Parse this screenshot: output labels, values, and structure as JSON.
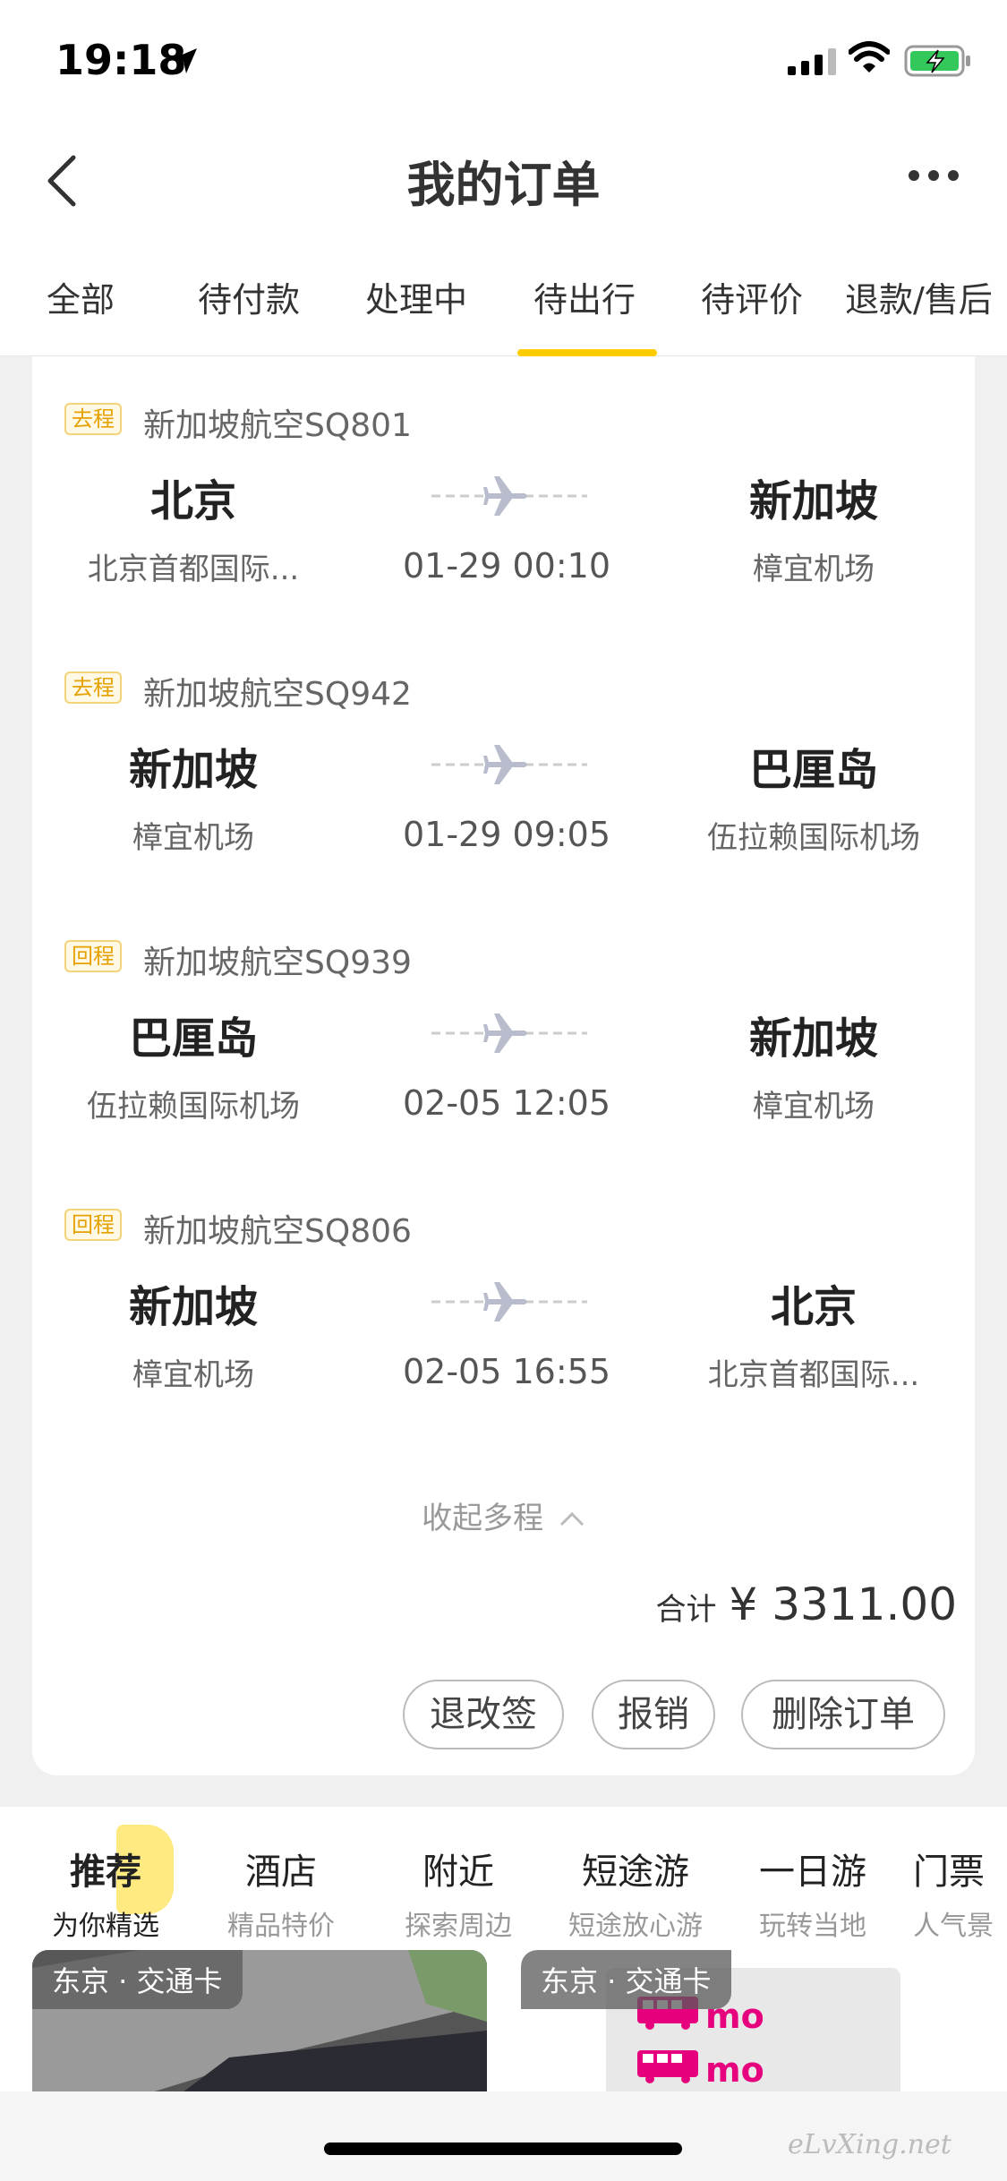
{
  "status_bar": {
    "time": "19:18"
  },
  "nav": {
    "title": "我的订单"
  },
  "tabs": [
    {
      "label": "全部"
    },
    {
      "label": "待付款"
    },
    {
      "label": "处理中"
    },
    {
      "label": "待出行"
    },
    {
      "label": "待评价"
    },
    {
      "label": "退款/售后"
    }
  ],
  "active_tab": "待出行",
  "order": {
    "segments": [
      {
        "tag": "去程",
        "airline": "新加坡航空SQ801",
        "from_city": "北京",
        "from_airport": "北京首都国际...",
        "to_city": "新加坡",
        "to_airport": "樟宜机场",
        "time": "01-29 00:10"
      },
      {
        "tag": "去程",
        "airline": "新加坡航空SQ942",
        "from_city": "新加坡",
        "from_airport": "樟宜机场",
        "to_city": "巴厘岛",
        "to_airport": "伍拉赖国际机场",
        "time": "01-29 09:05"
      },
      {
        "tag": "回程",
        "airline": "新加坡航空SQ939",
        "from_city": "巴厘岛",
        "from_airport": "伍拉赖国际机场",
        "to_city": "新加坡",
        "to_airport": "樟宜机场",
        "time": "02-05 12:05"
      },
      {
        "tag": "回程",
        "airline": "新加坡航空SQ806",
        "from_city": "新加坡",
        "from_airport": "樟宜机场",
        "to_city": "北京",
        "to_airport": "北京首都国际...",
        "time": "02-05 16:55"
      }
    ],
    "collapse_label": "收起多程",
    "total_label": "合计",
    "total_amount": "¥ 3311.00",
    "buttons": {
      "change": "退改签",
      "reimburse": "报销",
      "delete": "删除订单"
    }
  },
  "recommend": {
    "tabs": [
      {
        "title": "推荐",
        "sub": "为你精选"
      },
      {
        "title": "酒店",
        "sub": "精品特价"
      },
      {
        "title": "附近",
        "sub": "探索周边"
      },
      {
        "title": "短途游",
        "sub": "短途放心游"
      },
      {
        "title": "一日游",
        "sub": "玩转当地"
      },
      {
        "title": "门票",
        "sub": "人气景"
      }
    ],
    "cards": [
      {
        "label": "东京 · 交通卡"
      },
      {
        "label": "东京 · 交通卡",
        "brand": "mo"
      }
    ]
  },
  "watermark": "eLvXing.net",
  "colors": {
    "accent": "#ffcc00",
    "tag": "#e5a100",
    "brand_pink": "#e6007e"
  }
}
